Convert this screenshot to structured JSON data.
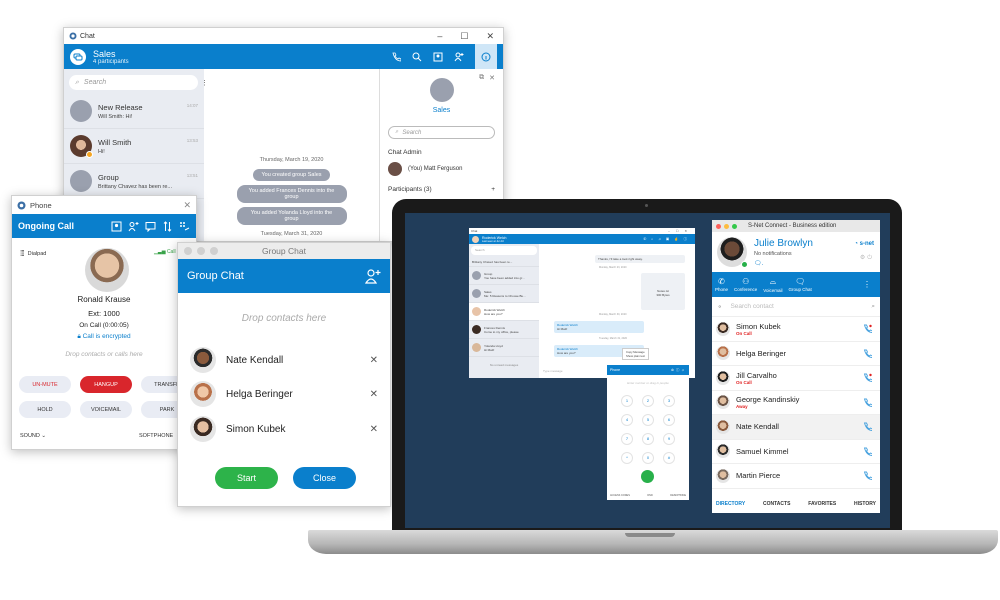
{
  "chat_window": {
    "title": "Chat",
    "header": {
      "name": "Sales",
      "subtitle": "4 participants"
    },
    "search_placeholder": "Search",
    "conversations": [
      {
        "name": "New Release",
        "preview": "Will Smith: Hi!",
        "time": "14:07"
      },
      {
        "name": "Will Smith",
        "preview": "Hi!",
        "time": "13:53"
      },
      {
        "name": "Group",
        "preview": "Brittany Chavez has been re...",
        "time": "13:51"
      }
    ],
    "messages": [
      {
        "type": "date",
        "text": "Thursday, March 19, 2020"
      },
      {
        "type": "system",
        "text": "You created group Sales"
      },
      {
        "type": "system",
        "text": "You added Frances Dennis into the group"
      },
      {
        "type": "system",
        "text": "You added Yolanda Lloyd into the group"
      },
      {
        "type": "date",
        "text": "Tuesday, March 31, 2020"
      }
    ],
    "info_panel": {
      "name": "Sales",
      "search_placeholder": "Search",
      "admin_label": "Chat Admin",
      "admin_name": "(You) Matt Ferguson",
      "participants_label": "Participants (3)",
      "add_icon": "+"
    }
  },
  "phone_window": {
    "title": "Phone",
    "header": "Ongoing Call",
    "dialpad_label": "Dialpad",
    "signal_text": "Call",
    "caller_name": "Ronald Krause",
    "caller_ext": "Ext: 1000",
    "call_status": "On Call (0:00:05)",
    "encryption": "Call is encrypted",
    "drop_hint": "Drop contacts or calls here",
    "buttons": {
      "unmute": "UN-MUTE",
      "hangup": "HANGUP",
      "transfer": "TRANSFE",
      "hold": "HOLD",
      "voicemail": "VOICEMAIL",
      "park": "PARK"
    },
    "footer": {
      "sound": "SOUND",
      "softphone": "SOFTPHONE"
    },
    "colors": {
      "hangup": "#d9262c",
      "unmute_text": "#d9262c"
    }
  },
  "group_chat": {
    "window_title": "Group Chat",
    "header": "Group Chat",
    "drop_hint": "Drop contacts here",
    "members": [
      {
        "name": "Nate Kendall"
      },
      {
        "name": "Helga Beringer"
      },
      {
        "name": "Simon Kubek"
      }
    ],
    "start_label": "Start",
    "close_label": "Close",
    "colors": {
      "start": "#2db34a",
      "close": "#0a7fcc"
    }
  },
  "laptop": {
    "mini_chat": {
      "title": "Chat",
      "header_name": "Roderick Welch",
      "header_sub": "Last seen at Jun 10",
      "search_placeholder": "Search",
      "conversations": [
        {
          "name": "",
          "preview": "Brittany Chavez has been re..."
        },
        {
          "name": "Group",
          "preview": "You have been added into gr..."
        },
        {
          "name": "Sales",
          "preview": "Me: 5 Reasons to Choose Bu..."
        },
        {
          "name": "Roderick Welch",
          "preview": "How are you?"
        },
        {
          "name": "Frances Dennis",
          "preview": "Come to my office, please"
        },
        {
          "name": "Yolanda Lloyd",
          "preview": "Hi Matt!"
        }
      ],
      "footer": "No unread messages",
      "input_placeholder": "Type message",
      "messages": {
        "m1": "Thanks, I'll take a look right away.",
        "d1": "Monday, March 23, 2020",
        "file1": "Notes.txt",
        "file2": "300 Bytes",
        "d2": "Monday, March 30, 2020",
        "sender": "Roderick Welch",
        "m2": "Hi Matt!",
        "d3": "Tuesday, March 31, 2020",
        "m3": "How are you?",
        "ctx1": "Copy Message",
        "ctx2": "Show plain text"
      }
    },
    "mini_phone": {
      "title": "Phone",
      "placeholder": "Enter number or drag in people",
      "keys": [
        {
          "d": "1",
          "l": ""
        },
        {
          "d": "2",
          "l": "ABC"
        },
        {
          "d": "3",
          "l": "DEF"
        },
        {
          "d": "4",
          "l": "GHI"
        },
        {
          "d": "5",
          "l": "JKL"
        },
        {
          "d": "6",
          "l": "MNO"
        },
        {
          "d": "7",
          "l": "PQRS"
        },
        {
          "d": "8",
          "l": "TUV"
        },
        {
          "d": "9",
          "l": "WXYZ"
        },
        {
          "d": "*",
          "l": ""
        },
        {
          "d": "0",
          "l": "+"
        },
        {
          "d": "#",
          "l": ""
        }
      ],
      "footer": [
        "ACCESS CODES",
        "DND",
        "DESKPHONE"
      ]
    },
    "snet": {
      "title": "S-Net Connect - Business edition",
      "user_name": "Julie Browlyn",
      "notifications": "No notifications",
      "logo": "s-net",
      "nav": [
        "Phone",
        "Conference",
        "Voicemail",
        "Group Chat"
      ],
      "search_placeholder": "Search contact",
      "contacts": [
        {
          "name": "Simon Kubek",
          "status": "On Call"
        },
        {
          "name": "Helga Beringer",
          "status": ""
        },
        {
          "name": "Jill Carvalho",
          "status": "On Call"
        },
        {
          "name": "George Kandinskiy",
          "status": "Away"
        },
        {
          "name": "Nate Kendall",
          "status": ""
        },
        {
          "name": "Samuel Kimmel",
          "status": ""
        },
        {
          "name": "Martin Pierce",
          "status": ""
        }
      ],
      "tabs": [
        "DIRECTORY",
        "CONTACTS",
        "FAVORITES",
        "HISTORY"
      ],
      "active_tab": "DIRECTORY",
      "colors": {
        "accent": "#0a7fcc",
        "status": "#e02020",
        "online": "#28b04a"
      }
    }
  }
}
